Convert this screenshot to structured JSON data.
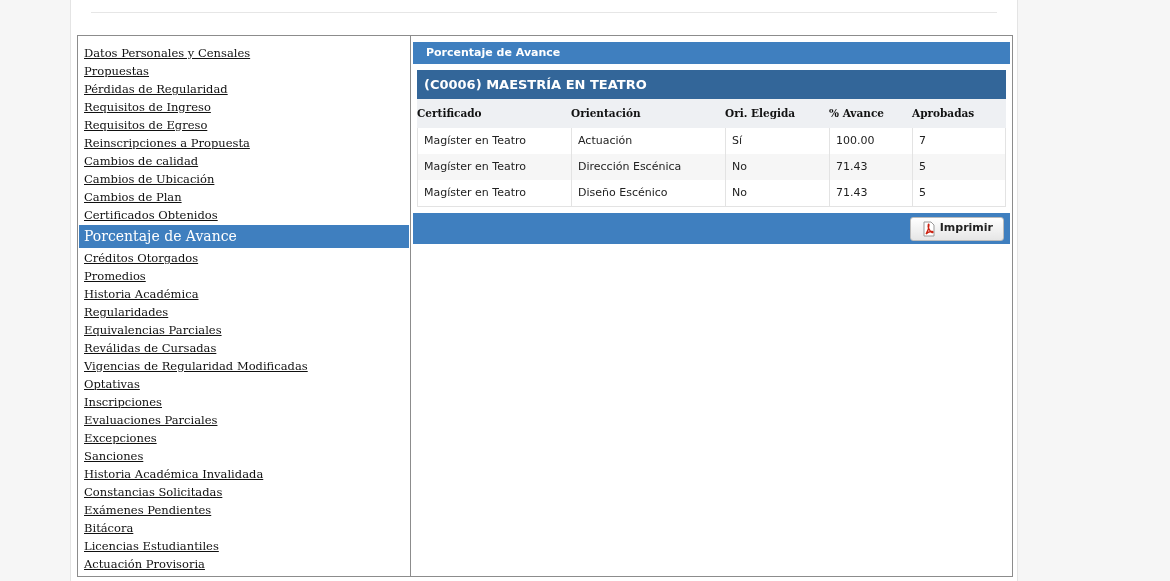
{
  "sidebar": {
    "items": [
      {
        "label": "Datos Personales y Censales",
        "selected": false
      },
      {
        "label": "Propuestas",
        "selected": false
      },
      {
        "label": "Pérdidas de Regularidad",
        "selected": false
      },
      {
        "label": "Requisitos de Ingreso",
        "selected": false
      },
      {
        "label": "Requisitos de Egreso",
        "selected": false
      },
      {
        "label": "Reinscripciones a Propuesta",
        "selected": false
      },
      {
        "label": "Cambios de calidad",
        "selected": false
      },
      {
        "label": "Cambios de Ubicación",
        "selected": false
      },
      {
        "label": "Cambios de Plan",
        "selected": false
      },
      {
        "label": "Certificados Obtenidos",
        "selected": false
      },
      {
        "label": "Porcentaje de Avance",
        "selected": true
      },
      {
        "label": "Créditos Otorgados",
        "selected": false
      },
      {
        "label": "Promedios",
        "selected": false
      },
      {
        "label": "Historia Académica",
        "selected": false
      },
      {
        "label": "Regularidades",
        "selected": false
      },
      {
        "label": "Equivalencias Parciales",
        "selected": false
      },
      {
        "label": "Reválidas de Cursadas",
        "selected": false
      },
      {
        "label": "Vigencias de Regularidad Modificadas",
        "selected": false
      },
      {
        "label": "Optativas",
        "selected": false
      },
      {
        "label": "Inscripciones",
        "selected": false
      },
      {
        "label": "Evaluaciones Parciales",
        "selected": false
      },
      {
        "label": "Excepciones",
        "selected": false
      },
      {
        "label": "Sanciones",
        "selected": false
      },
      {
        "label": "Historia Académica Invalidada",
        "selected": false
      },
      {
        "label": "Constancias Solicitadas",
        "selected": false
      },
      {
        "label": "Exámenes Pendientes",
        "selected": false
      },
      {
        "label": "Bitácora",
        "selected": false
      },
      {
        "label": "Licencias Estudiantiles",
        "selected": false
      },
      {
        "label": "Actuación Provisoria",
        "selected": false
      }
    ]
  },
  "panel": {
    "title": "Porcentaje de Avance",
    "career": "(C0006) MAESTRÍA EN TEATRO",
    "table": {
      "columns": [
        "Certificado",
        "Orientación",
        "Ori. Elegida",
        "% Avance",
        "Aprobadas"
      ],
      "rows": [
        [
          "Magíster en Teatro",
          "Actuación",
          "Sí",
          "100.00",
          "7"
        ],
        [
          "Magíster en Teatro",
          "Dirección Escénica",
          "No",
          "71.43",
          "5"
        ],
        [
          "Magíster en Teatro",
          "Diseño Escénico",
          "No",
          "71.43",
          "5"
        ]
      ]
    },
    "print_button": "Imprimir"
  }
}
